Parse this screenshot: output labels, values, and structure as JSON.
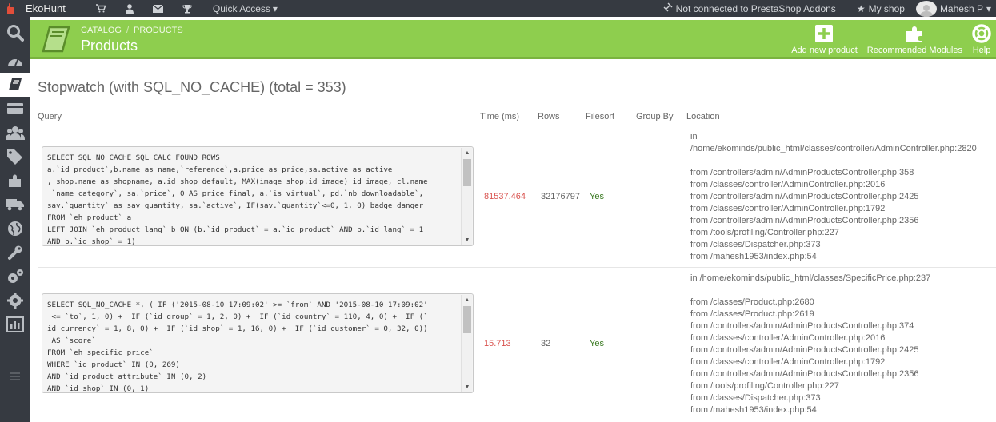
{
  "topbar": {
    "brand": "EkoHunt",
    "quick_access": "Quick Access",
    "addons": "Not connected to PrestaShop Addons",
    "my_shop": "My shop",
    "user": "Mahesh P"
  },
  "header": {
    "breadcrumb": [
      "CATALOG",
      "PRODUCTS"
    ],
    "breadcrumb_sep": "/",
    "title": "Products",
    "toolbar": [
      "Add new product",
      "Recommended Modules",
      "Help"
    ]
  },
  "stopwatch": {
    "title": "Stopwatch (with SQL_NO_CACHE) (total = 353)",
    "columns": [
      "Query",
      "Time (ms)",
      "Rows",
      "Filesort",
      "Group By",
      "Location"
    ],
    "rows": [
      {
        "query": "SELECT SQL_NO_CACHE SQL_CALC_FOUND_ROWS\na.`id_product`,b.name as name,`reference`,a.price as price,sa.active as active\n, shop.name as shopname, a.id_shop_default, MAX(image_shop.id_image) id_image, cl.name\n `name_category`, sa.`price`, 0 AS price_final, a.`is_virtual`, pd.`nb_downloadable`,\nsav.`quantity` as sav_quantity, sa.`active`, IF(sav.`quantity`<=0, 1, 0) badge_danger\nFROM `eh_product` a\nLEFT JOIN `eh_product_lang` b ON (b.`id_product` = a.`id_product` AND b.`id_lang` = 1\nAND b.`id_shop` = 1)",
        "time": "81537.464",
        "rows": "32176797",
        "filesort": "Yes",
        "group_by": "",
        "location_head": [
          "in",
          "/home/ekominds/public_html/classes/controller/AdminController.php:2820"
        ],
        "location": [
          "from /controllers/admin/AdminProductsController.php:358",
          "from /classes/controller/AdminController.php:2016",
          "from /controllers/admin/AdminProductsController.php:2425",
          "from /classes/controller/AdminController.php:1792",
          "from /controllers/admin/AdminProductsController.php:2356",
          "from /tools/profiling/Controller.php:227",
          "from /classes/Dispatcher.php:373",
          "from /mahesh1953/index.php:54"
        ]
      },
      {
        "query": "SELECT SQL_NO_CACHE *, ( IF ('2015-08-10 17:09:02' >= `from` AND '2015-08-10 17:09:02'\n <= `to`, 1, 0) +  IF (`id_group` = 1, 2, 0) +  IF (`id_country` = 110, 4, 0) +  IF (`\nid_currency` = 1, 8, 0) +  IF (`id_shop` = 1, 16, 0) +  IF (`id_customer` = 0, 32, 0))\n AS `score`\nFROM `eh_specific_price`\nWHERE `id_product` IN (0, 269)\nAND `id_product_attribute` IN (0, 2)\nAND `id_shop` IN (0, 1)",
        "time": "15.713",
        "rows": "32",
        "filesort": "Yes",
        "group_by": "",
        "location_head": [
          "in /home/ekominds/public_html/classes/SpecificPrice.php:237"
        ],
        "location": [
          "from /classes/Product.php:2680",
          "from /classes/Product.php:2619",
          "from /controllers/admin/AdminProductsController.php:374",
          "from /classes/controller/AdminController.php:2016",
          "from /controllers/admin/AdminProductsController.php:2425",
          "from /classes/controller/AdminController.php:1792",
          "from /controllers/admin/AdminProductsController.php:2356",
          "from /tools/profiling/Controller.php:227",
          "from /classes/Dispatcher.php:373",
          "from /mahesh1953/index.php:54"
        ]
      }
    ]
  },
  "icons": {
    "topbar": [
      "cart-icon",
      "user-icon",
      "envelope-icon",
      "trophy-icon"
    ],
    "sidebar": [
      "search-icon",
      "dashboard-icon",
      "catalog-icon",
      "orders-icon",
      "customers-icon",
      "price-rules-icon",
      "modules-icon",
      "shipping-icon",
      "localization-icon",
      "preferences-icon",
      "advanced-parameters-icon",
      "administration-icon",
      "stats-icon",
      "menu-toggle-icon"
    ]
  },
  "colors": {
    "header": "#8ece4e",
    "dark": "#363a41",
    "time": "#d9534f",
    "yes": "#3a7a22"
  }
}
